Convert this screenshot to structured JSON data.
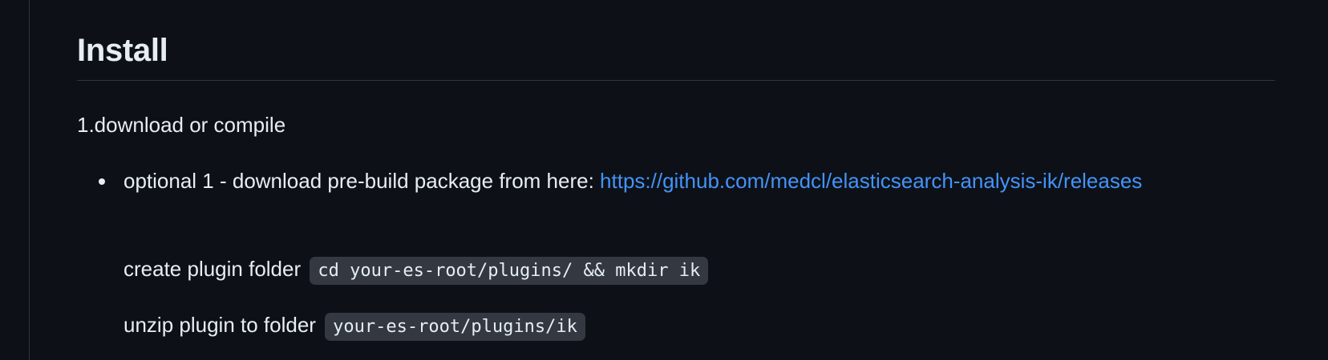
{
  "section": {
    "heading": "Install",
    "step_text": "1.download or compile",
    "bullet": {
      "text": "optional 1 - download pre-build package from here: ",
      "link_text": "https://github.com/medcl/elasticsearch-analysis-ik/releases"
    },
    "create_folder": {
      "text": "create plugin folder ",
      "code": "cd your-es-root/plugins/ && mkdir ik"
    },
    "unzip": {
      "text": "unzip plugin to folder ",
      "code": "your-es-root/plugins/ik"
    }
  },
  "colors": {
    "background": "#0d1117",
    "text": "#e6edf3",
    "link": "#4493f8",
    "code_bg": "#343941",
    "border": "#30363d"
  }
}
